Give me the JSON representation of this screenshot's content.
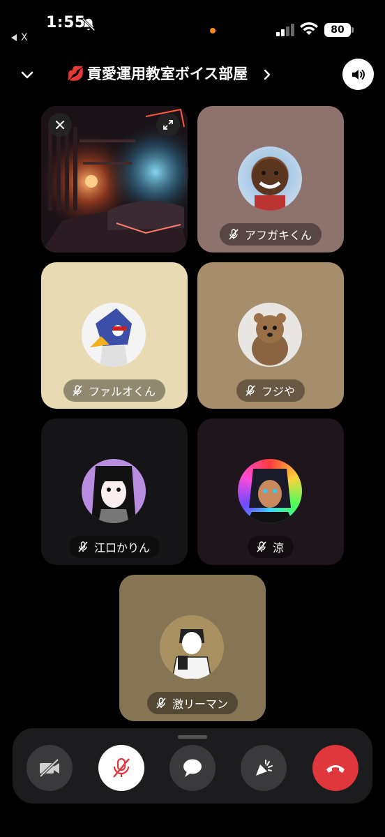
{
  "status_bar": {
    "time": "1:55",
    "back_app": "X",
    "battery": "80"
  },
  "header": {
    "room_emoji": "💋",
    "room_title": "貢愛運用教室ボイス部屋"
  },
  "participants": [
    {
      "name": "アフガキくん",
      "muted": true,
      "tile_color": "#8e726e"
    },
    {
      "name": "ファルオくん",
      "muted": true,
      "tile_color": "#e8dbb3"
    },
    {
      "name": "フジや",
      "muted": true,
      "tile_color": "#a68d6c"
    },
    {
      "name": "江口かりん",
      "muted": true,
      "tile_color": "#151517"
    },
    {
      "name": "涼",
      "muted": true,
      "tile_color": "#1f151c"
    },
    {
      "name": "激リーマン",
      "muted": true,
      "tile_color": "#867555"
    }
  ],
  "icons": {
    "video_off": "camera-off-icon",
    "mic_off": "mic-off-icon",
    "chat": "chat-bubble-icon",
    "reaction": "party-popper-icon",
    "end_call": "phone-hangup-icon"
  },
  "colors": {
    "end_call": "#e0373c",
    "control_bg": "#3a3a3c"
  }
}
